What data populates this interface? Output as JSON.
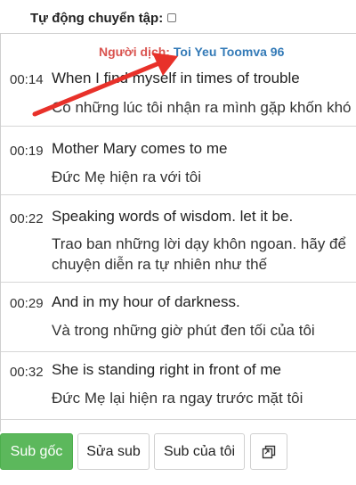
{
  "autoplay": {
    "label": "Tự động chuyển tập:",
    "checked": false
  },
  "translator": {
    "label": "Người dịch:",
    "name": "Toi Yeu Toomva 96"
  },
  "subtitles": [
    {
      "time": "00:14",
      "original": "When I find myself in times of trouble",
      "translation_lines": [
        "Có những lúc tôi nhận ra mình gặp khốn khó"
      ]
    },
    {
      "time": "00:19",
      "original": "Mother Mary comes to me",
      "translation_lines": [
        "Đức Mẹ hiện ra với tôi"
      ]
    },
    {
      "time": "00:22",
      "original": "Speaking words of wisdom. let it be.",
      "translation_lines": [
        "Trao ban những lời dạy khôn ngoan. hãy để",
        "chuyện diễn ra tự nhiên như thế"
      ]
    },
    {
      "time": "00:29",
      "original": "And in my hour of darkness.",
      "translation_lines": [
        "Và trong những giờ phút đen tối của tôi"
      ]
    },
    {
      "time": "00:32",
      "original": "She is standing right in front of me",
      "translation_lines": [
        "Đức Mẹ lại hiện ra ngay trước mặt tôi"
      ]
    }
  ],
  "toolbar": {
    "original_sub": "Sub gốc",
    "edit_sub": "Sửa sub",
    "my_sub": "Sub của tôi",
    "copy_icon": "copy-icon"
  },
  "colors": {
    "active_tab": "#5cb85c",
    "translator_label": "#d9534f",
    "translator_name": "#337ab7",
    "arrow": "#e8312a"
  }
}
